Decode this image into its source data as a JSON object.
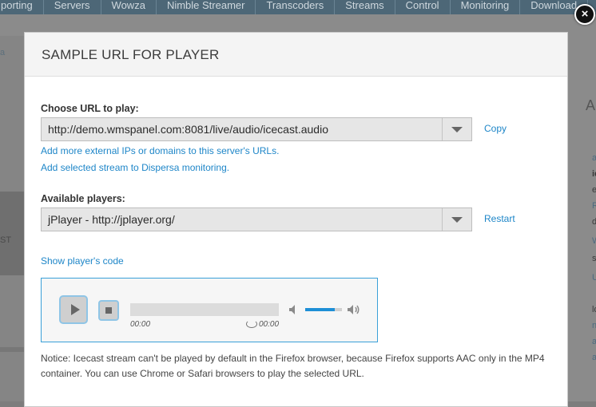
{
  "background": {
    "nav": [
      "porting",
      "Servers",
      "Wowza",
      "Nimble Streamer",
      "Transcoders",
      "Streams",
      "Control",
      "Monitoring",
      "Download"
    ],
    "left_fragments": [
      "a",
      "ST"
    ],
    "right_fragments": [
      "A",
      "am",
      "io",
      "ecs",
      "R",
      "d",
      "W",
      "s",
      "U",
      "ld",
      "nge",
      "ame",
      "abi"
    ]
  },
  "modal": {
    "title": "SAMPLE URL FOR PLAYER",
    "close_glyph": "×",
    "url_label": "Choose URL to play:",
    "url_value": "http://demo.wmspanel.com:8081/live/audio/icecast.audio",
    "copy_label": "Copy",
    "add_ips_link": "Add more external IPs or domains to this server's URLs.",
    "add_dispersa_link": "Add selected stream to Dispersa monitoring.",
    "players_label": "Available players:",
    "player_value": "jPlayer - http://jplayer.org/",
    "restart_label": "Restart",
    "show_code_link": "Show player's code",
    "notice": "Notice: Icecast stream can't be played by default in the Firefox browser, because Firefox supports AAC only in the MP4 container. You can use Chrome or Safari browsers to play the selected URL."
  },
  "player": {
    "current_time": "00:00",
    "duration": "00:00",
    "volume_level": 0.8,
    "icons": [
      "play-icon",
      "stop-icon",
      "repeat-icon",
      "mute-icon",
      "volume-max-icon"
    ]
  },
  "colors": {
    "accent": "#1e86c8",
    "player_border": "#3aa0d8",
    "volume": "#1e8fd6"
  }
}
